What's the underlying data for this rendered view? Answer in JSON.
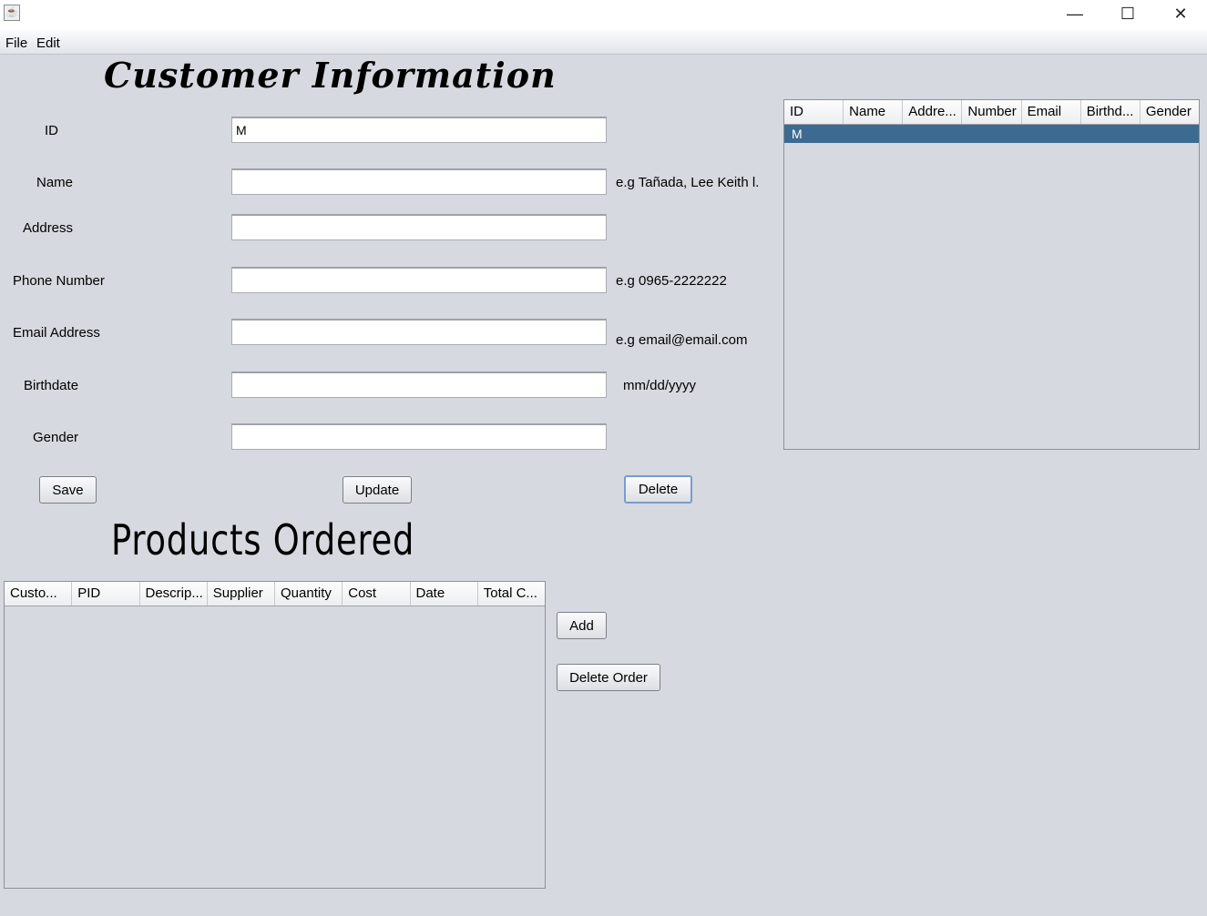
{
  "window": {
    "app_icon": "java-coffee-icon",
    "minimize": "—",
    "maximize": "☐",
    "close": "✕"
  },
  "menu": [
    "File",
    "Edit"
  ],
  "customer": {
    "heading": "Customer Information",
    "fields": {
      "id": {
        "label": "ID",
        "value": "M"
      },
      "name": {
        "label": "Name",
        "value": "",
        "hint": "e.g Tañada, Lee Keith l."
      },
      "address": {
        "label": "Address",
        "value": ""
      },
      "phone": {
        "label": "Phone Number",
        "value": "",
        "hint": "e.g 0965-2222222"
      },
      "email": {
        "label": "Email Address",
        "value": "",
        "hint": "e.g email@email.com"
      },
      "birthdate": {
        "label": "Birthdate",
        "value": "",
        "hint": "mm/dd/yyyy"
      },
      "gender": {
        "label": "Gender",
        "value": ""
      }
    },
    "buttons": {
      "save": "Save",
      "update": "Update",
      "delete": "Delete"
    }
  },
  "customer_table": {
    "columns": [
      "ID",
      "Name",
      "Addre...",
      "Number",
      "Email",
      "Birthd...",
      "Gender"
    ],
    "rows": [
      [
        "M",
        "",
        "",
        "",
        "",
        "",
        ""
      ]
    ]
  },
  "products": {
    "heading": "Products Ordered",
    "columns": [
      "Custo...",
      "PID",
      "Descrip...",
      "Supplier",
      "Quantity",
      "Cost",
      "Date",
      "Total C..."
    ],
    "buttons": {
      "add": "Add",
      "delete_order": "Delete Order"
    }
  }
}
